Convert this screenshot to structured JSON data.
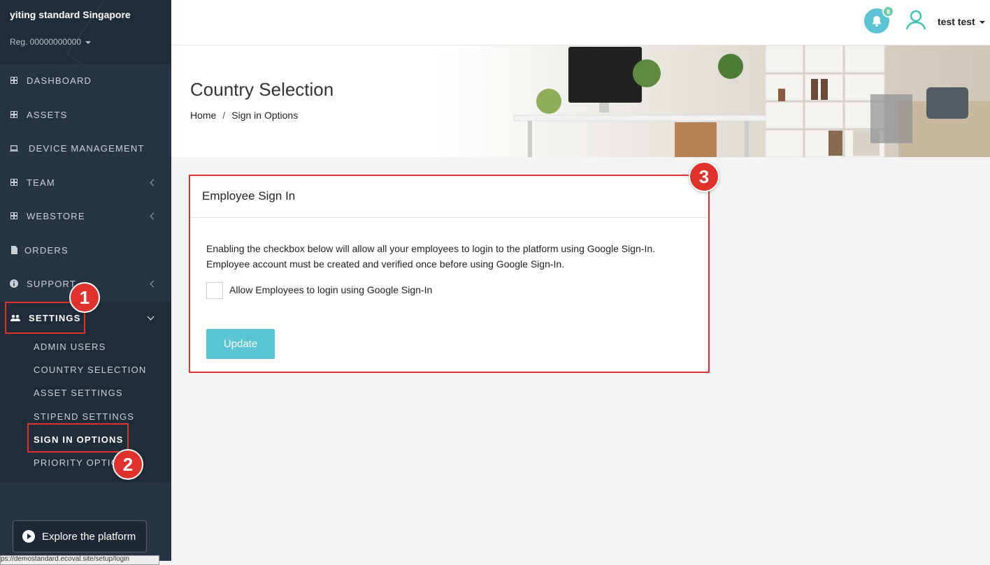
{
  "org": {
    "name": "yiting standard Singapore",
    "reg": "Reg. 00000000000"
  },
  "nav": [
    {
      "label": "DASHBOARD"
    },
    {
      "label": "ASSETS"
    },
    {
      "label": "DEVICE MANAGEMENT"
    },
    {
      "label": "TEAM"
    },
    {
      "label": "WEBSTORE"
    },
    {
      "label": "ORDERS"
    },
    {
      "label": "SUPPORT"
    }
  ],
  "settings": {
    "label": "SETTINGS",
    "items": [
      {
        "label": "ADMIN USERS"
      },
      {
        "label": "COUNTRY SELECTION"
      },
      {
        "label": "ASSET SETTINGS"
      },
      {
        "label": "STIPEND SETTINGS"
      },
      {
        "label": "SIGN IN OPTIONS"
      },
      {
        "label": "PRIORITY OPTIC"
      }
    ]
  },
  "explore": {
    "label": "Explore the platform"
  },
  "status_url": "ps://demostandard.ecoval.site/setup/login",
  "topbar": {
    "notif_count": "8",
    "user_name": "test test"
  },
  "page": {
    "title": "Country Selection",
    "breadcrumb": {
      "home": "Home",
      "sep": "/",
      "current": "Sign in Options"
    }
  },
  "card": {
    "title": "Employee Sign In",
    "desc_line1": "Enabling the checkbox below will allow all your employees to login to the platform using Google Sign-In.",
    "desc_line2": "Employee account must be created and verified once before using Google Sign-In.",
    "checkbox_label": "Allow Employees to login using Google Sign-In",
    "checkbox_checked": false,
    "button_label": "Update"
  },
  "annotations": {
    "step1": "1",
    "step2": "2",
    "step3": "3"
  },
  "colors": {
    "sidebar": "#253544",
    "accent": "#5bc4d4",
    "annotation": "#e0322c"
  }
}
